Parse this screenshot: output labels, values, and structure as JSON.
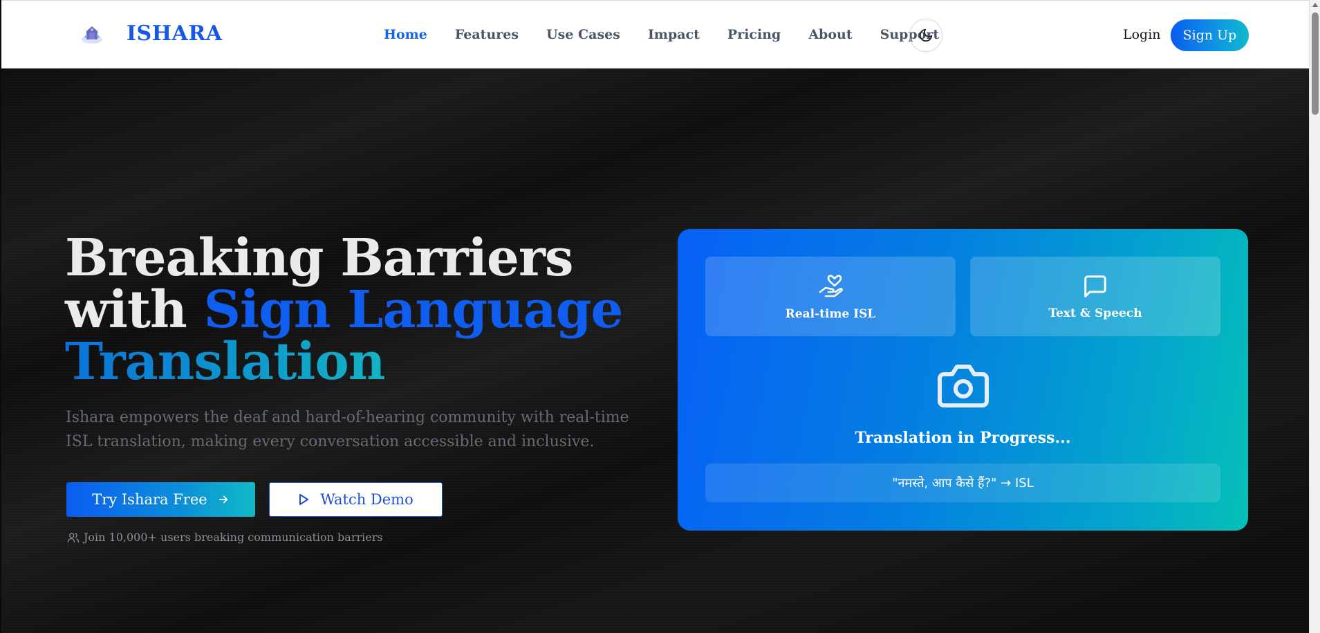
{
  "nav": {
    "brand": "ISHARA",
    "links": [
      {
        "label": "Home",
        "active": true
      },
      {
        "label": "Features"
      },
      {
        "label": "Use Cases"
      },
      {
        "label": "Impact"
      },
      {
        "label": "Pricing"
      },
      {
        "label": "About"
      },
      {
        "label": "Support"
      }
    ],
    "theme_icon": "moon-icon",
    "login": "Login",
    "signup": "Sign Up"
  },
  "hero": {
    "headline_line1": "Breaking Barriers",
    "headline_with": "with ",
    "headline_highlight": "Sign Language",
    "headline_line3": "Translation",
    "subtext": "Ishara empowers the deaf and hard-of-hearing community with real-time ISL translation, making every conversation accessible and inclusive.",
    "primary_button": "Try Ishara Free",
    "secondary_button": "Watch Demo",
    "join_text": "Join 10,000+ users breaking communication barriers"
  },
  "card": {
    "feature_1": "Real-time ISL",
    "feature_2": "Text & Speech",
    "status": "Translation in Progress...",
    "phrase": "\"नमस्ते, आप कैसे हैं?\" → ISL"
  },
  "colors": {
    "brand_blue": "#1558e6",
    "accent_teal": "#11b9c8",
    "nav_active": "#1564e8"
  }
}
